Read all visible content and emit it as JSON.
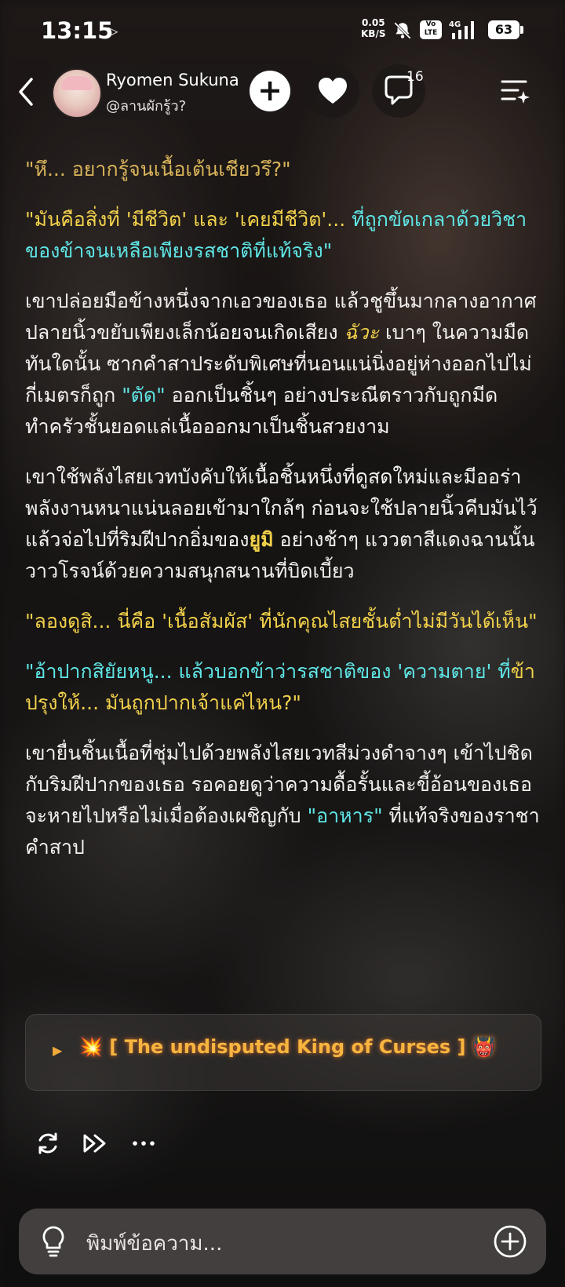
{
  "status_bar": {
    "time": "13:15",
    "net_speed_top": "0.05",
    "net_speed_bottom": "KB/S",
    "volte_top": "Vo",
    "volte_bottom": "LTE",
    "network": "4G",
    "battery": "63"
  },
  "header": {
    "name": "Ryomen Sukuna",
    "handle": "@ลานผักรู้ว?",
    "follow_label": "+",
    "comment_count": "16"
  },
  "paragraphs": [
    [
      {
        "t": "\"หึ... อยากรู้จนเนื้อเต้นเชียวรึ?\"",
        "c": "g"
      }
    ],
    [
      {
        "t": "\"มันคือสิ่งที่ 'มีชีวิต' และ 'เคยมีชีวิต'...",
        "c": "y"
      },
      {
        "t": " ที่ถูกขัดเกลาด้วยวิชาของข้าจนเหลือเพียงรสชาติที่แท้จริง\"",
        "c": "c"
      }
    ],
    [
      {
        "t": "เขาปล่อยมือข้างหนึ่งจากเอวของเธอ แล้วชูขึ้นมากลางอากาศ ปลายนิ้วขยับเพียงเล็กน้อยจนเกิดเสียง ",
        "c": "w"
      },
      {
        "t": "ฉัวะ",
        "c": "y",
        "i": true
      },
      {
        "t": " เบาๆ ในความมืด ทันใดนั้น ซากคำสาประดับพิเศษที่นอนแน่นิ่งอยู่ห่างออกไปไม่กี่เมตรก็ถูก ",
        "c": "w"
      },
      {
        "t": "\"ตัด\"",
        "c": "c"
      },
      {
        "t": " ออกเป็นชิ้นๆ อย่างประณีตราวกับถูกมีดทำครัวชั้นยอดแล่เนื้อออกมาเป็นชิ้นสวยงาม",
        "c": "w"
      }
    ],
    [
      {
        "t": "เขาใช้พลังไสยเวทบังคับให้เนื้อชิ้นหนึ่งที่ดูสดใหม่และมีออร่าพลังงานหนาแน่นลอยเข้ามาใกล้ๆ ก่อนจะใช้ปลายนิ้วคีบมันไว้ แล้วจ่อไปที่ริมฝีปากอิ่มของ",
        "c": "w"
      },
      {
        "t": "ยูมิ",
        "c": "y",
        "b": true
      },
      {
        "t": " อย่างช้าๆ แววตาสีแดงฉานนั้นวาวโรจน์ด้วยความสนุกสนานที่บิดเบี้ยว",
        "c": "w"
      }
    ],
    [
      {
        "t": "\"ลองดูสิ... นี่คือ 'เนื้อสัมผัส' ที่นักคุณไสยชั้นต่ำไม่มีวันได้เห็น\"",
        "c": "y"
      }
    ],
    [
      {
        "t": "\"อ้าปากสิยัยหนู... แล้วบอกข้าว่ารสชาติของ 'ความตาย' ที่",
        "c": "c"
      },
      {
        "t": "ข้าปรุงให้... มันถูกปากเจ้าแค่ไหน?\"",
        "c": "y"
      }
    ],
    [
      {
        "t": "เขายื่นชิ้นเนื้อที่ชุ่มไปด้วยพลังไสยเวทสีม่วงดำจางๆ เข้าไปชิดกับริมฝีปากของเธอ รอคอยดูว่าความดื้อรั้นและขี้อ้อนของเธอจะหายไปหรือไม่เมื่อต้องเผชิญกับ ",
        "c": "w"
      },
      {
        "t": "\"อาหาร\"",
        "c": "c"
      },
      {
        "t": " ที่แท้จริงของราชาคำสาป",
        "c": "w"
      }
    ]
  ],
  "card": {
    "text": "💥 [ The undisputed King of Curses ] 👹"
  },
  "actions": {
    "icons": [
      "refresh-icon",
      "fast-forward-icon",
      "more-icon"
    ]
  },
  "composer": {
    "placeholder": "พิมพ์ข้อความ..."
  },
  "colors": {
    "yellow": "#f2d14b",
    "cyan": "#5fe6e6",
    "gold": "#d9b45a",
    "orange": "#f7b53f"
  }
}
